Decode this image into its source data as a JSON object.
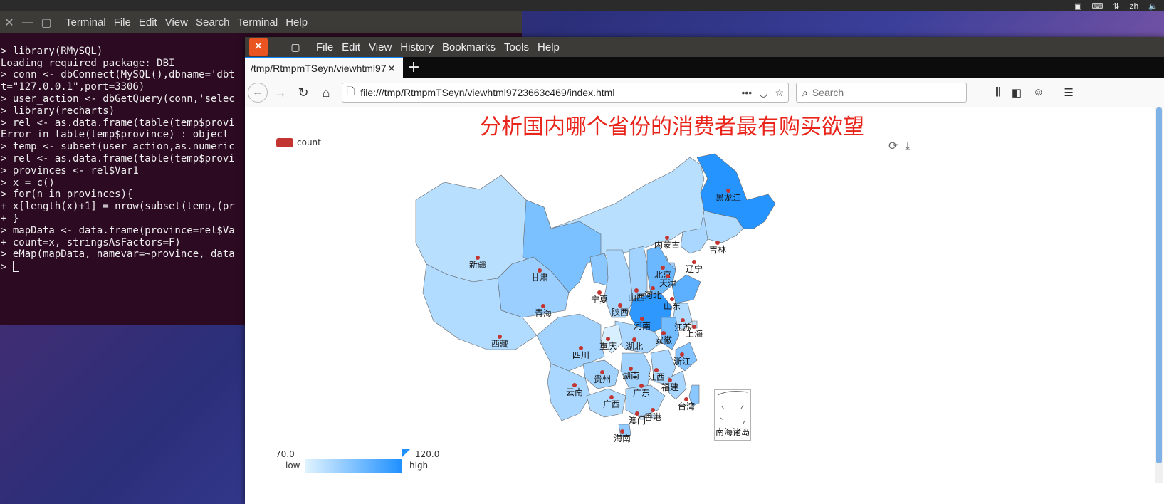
{
  "terminal": {
    "menu": [
      "Terminal",
      "File",
      "Edit",
      "View",
      "Search",
      "Terminal",
      "Help"
    ],
    "lines": [
      "> library(RMySQL)",
      "Loading required package: DBI",
      "> conn <- dbConnect(MySQL(),dbname='dbt",
      "t=\"127.0.0.1\",port=3306)",
      "> user_action <- dbGetQuery(conn,'selec",
      "> library(recharts)",
      "> rel <- as.data.frame(table(temp$provi",
      "Error in table(temp$province) : object",
      "> temp <- subset(user_action,as.numeric",
      "> rel <- as.data.frame(table(temp$provi",
      "> provinces <- rel$Var1",
      "> x = c()",
      "> for(n in provinces){",
      "+ x[length(x)+1] = nrow(subset(temp,(pr",
      "+ }",
      "> mapData <- data.frame(province=rel$Va",
      "+ count=x, stringsAsFactors=F)",
      "> eMap(mapData, namevar=~province, data",
      "> "
    ]
  },
  "firefox": {
    "menu": [
      "File",
      "Edit",
      "View",
      "History",
      "Bookmarks",
      "Tools",
      "Help"
    ],
    "tab_title": "/tmp/RtmpmTSeyn/viewhtml9723663c469/index.html",
    "url": "file:///tmp/RtmpmTSeyn/viewhtml9723663c469/index.html",
    "search_placeholder": "Search"
  },
  "chart_title": "分析国内哪个省份的消费者最有购买欲望",
  "legend_label": "count",
  "visual_map": {
    "min_label": "70.0",
    "max_label": "120.0",
    "low": "low",
    "high": "high"
  },
  "colors": {
    "low": "#e0f3ff",
    "high": "#1e90ff",
    "marker": "#c23531",
    "title": "#e8241b"
  },
  "chart_data": {
    "type": "heatmap",
    "title": "分析国内哪个省份的消费者最有购买欲望",
    "series": [
      {
        "name": "count"
      }
    ],
    "range": [
      70.0,
      120.0
    ],
    "provinces": [
      {
        "name": "黑龙江",
        "value": 118
      },
      {
        "name": "吉林",
        "value": 82
      },
      {
        "name": "辽宁",
        "value": 84
      },
      {
        "name": "内蒙古",
        "value": 80
      },
      {
        "name": "新疆",
        "value": 80
      },
      {
        "name": "甘肃",
        "value": 96
      },
      {
        "name": "青海",
        "value": 88
      },
      {
        "name": "西藏",
        "value": 82
      },
      {
        "name": "宁夏",
        "value": 92
      },
      {
        "name": "陕西",
        "value": 84
      },
      {
        "name": "山西",
        "value": 86
      },
      {
        "name": "北京",
        "value": 84
      },
      {
        "name": "天津",
        "value": 88
      },
      {
        "name": "河北",
        "value": 100
      },
      {
        "name": "山东",
        "value": 104
      },
      {
        "name": "河南",
        "value": 116
      },
      {
        "name": "江苏",
        "value": 82
      },
      {
        "name": "上海",
        "value": 78
      },
      {
        "name": "安徽",
        "value": 98
      },
      {
        "name": "湖北",
        "value": 84
      },
      {
        "name": "重庆",
        "value": 72
      },
      {
        "name": "四川",
        "value": 86
      },
      {
        "name": "浙江",
        "value": 94
      },
      {
        "name": "江西",
        "value": 84
      },
      {
        "name": "湖南",
        "value": 86
      },
      {
        "name": "贵州",
        "value": 86
      },
      {
        "name": "云南",
        "value": 84
      },
      {
        "name": "福建",
        "value": 84
      },
      {
        "name": "广西",
        "value": 82
      },
      {
        "name": "广东",
        "value": 84
      },
      {
        "name": "台湾",
        "value": 92
      },
      {
        "name": "香港",
        "value": 74
      },
      {
        "name": "澳门",
        "value": 74
      },
      {
        "name": "海南",
        "value": 90
      },
      {
        "name": "南海诸岛",
        "value": 70
      }
    ]
  }
}
